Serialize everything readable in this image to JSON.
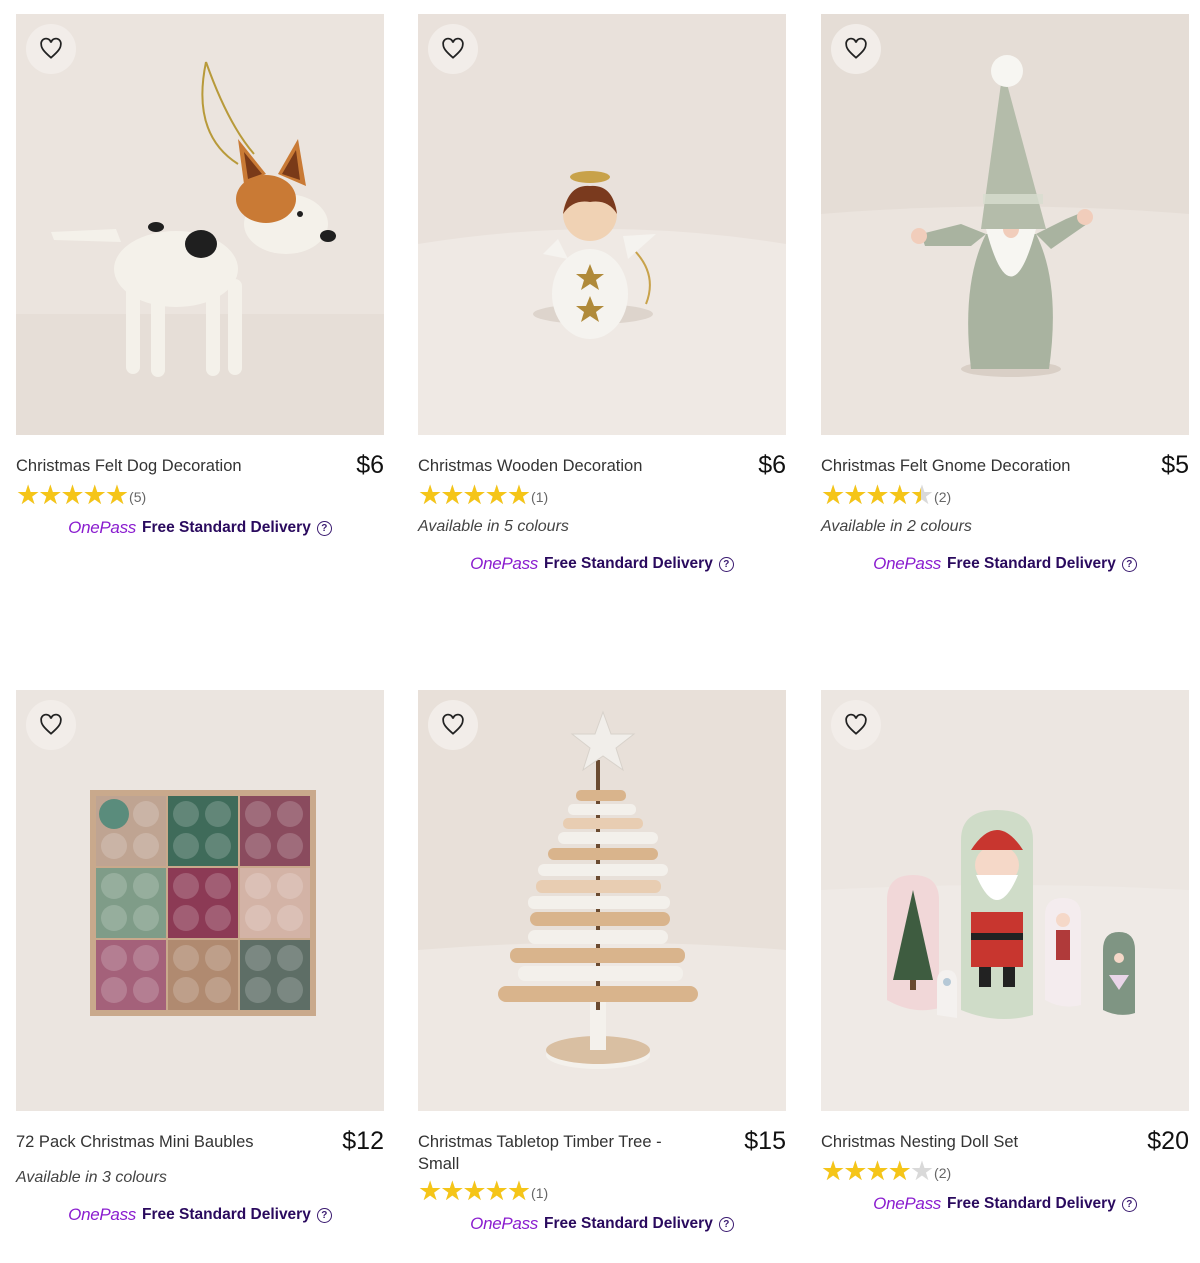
{
  "products": [
    {
      "title": "Christmas Felt Dog Decoration",
      "price": "$6",
      "rating": 5,
      "rating_count": "(5)",
      "colours": "",
      "onepass": "OnePass",
      "delivery": "Free Standard Delivery"
    },
    {
      "title": "Christmas Wooden Decoration",
      "price": "$6",
      "rating": 5,
      "rating_count": "(1)",
      "colours": "Available in 5 colours",
      "onepass": "OnePass",
      "delivery": "Free Standard Delivery"
    },
    {
      "title": "Christmas Felt Gnome Decoration",
      "price": "$5",
      "rating": 4.5,
      "rating_count": "(2)",
      "colours": "Available in 2 colours",
      "onepass": "OnePass",
      "delivery": "Free Standard Delivery"
    },
    {
      "title": "72 Pack Christmas Mini Baubles",
      "price": "$12",
      "rating": null,
      "rating_count": "",
      "colours": "Available in 3 colours",
      "onepass": "OnePass",
      "delivery": "Free Standard Delivery"
    },
    {
      "title": "Christmas Tabletop Timber Tree - Small",
      "price": "$15",
      "rating": 5,
      "rating_count": "(1)",
      "colours": "",
      "onepass": "OnePass",
      "delivery": "Free Standard Delivery"
    },
    {
      "title": "Christmas Nesting Doll Set",
      "price": "$20",
      "rating": 4,
      "rating_count": "(2)",
      "colours": "",
      "onepass": "OnePass",
      "delivery": "Free Standard Delivery"
    }
  ],
  "icons": {
    "wishlist": "heart-outline-icon",
    "star": "star-icon",
    "help": "question-circle-icon"
  },
  "colors": {
    "onepass": "#8a1ccf",
    "delivery": "#2a0a5e",
    "star": "#f5c518",
    "star_empty": "#d9d9d9"
  },
  "help_glyph": "?"
}
